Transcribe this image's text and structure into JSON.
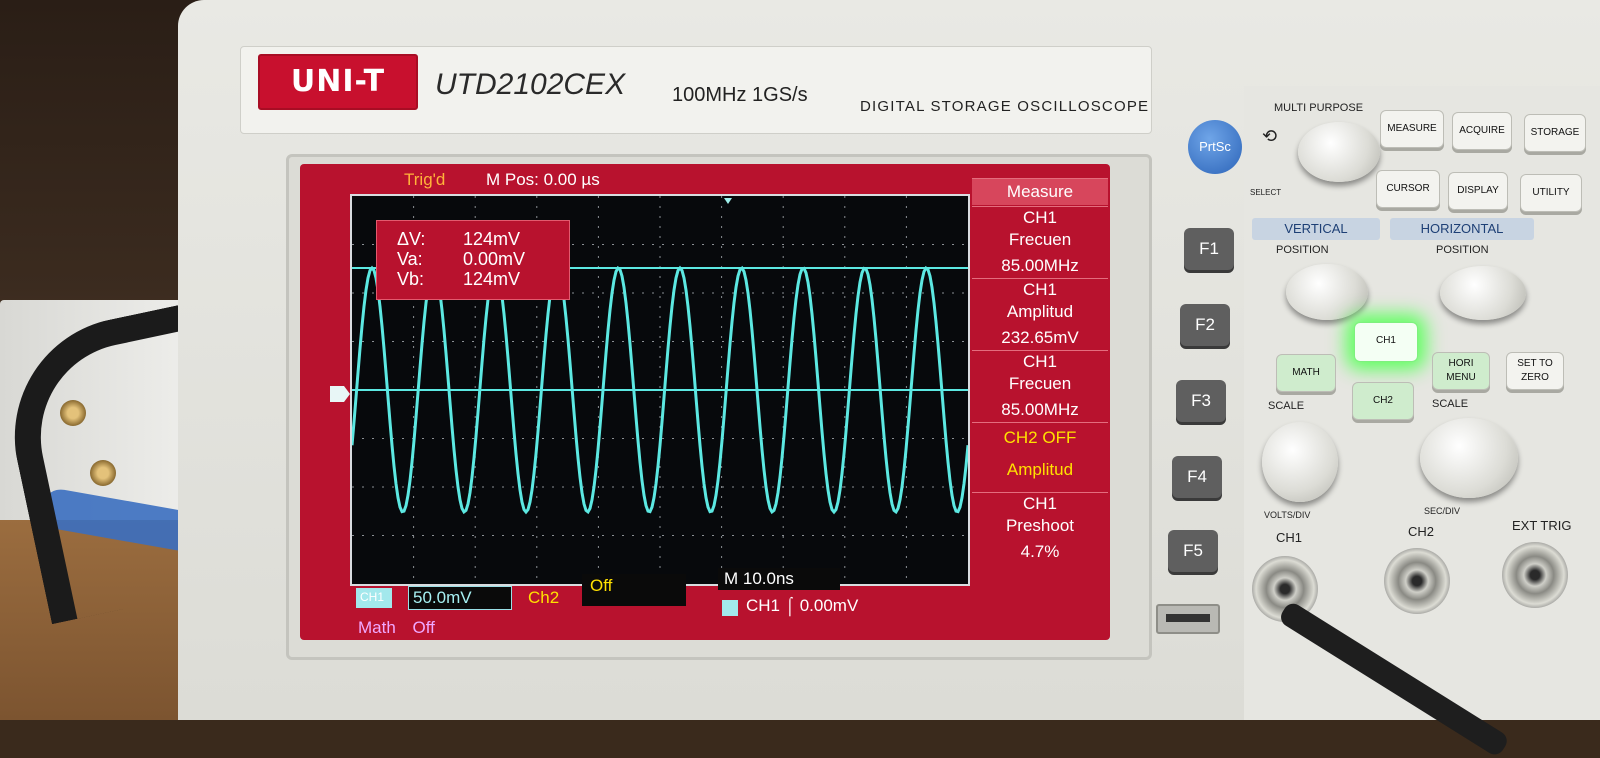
{
  "device": {
    "brand": "UNI-T",
    "model": "UTD2102CEX",
    "spec": "100MHz  1GS/s",
    "description": "DIGITAL STORAGE OSCILLOSCOPE"
  },
  "screen": {
    "status": "Trig'd",
    "m_pos": "M Pos: 0.00 µs",
    "cursor": {
      "dv_label": "ΔV:",
      "dv_value": "124mV",
      "va_label": "Va:",
      "va_value": "0.00mV",
      "vb_label": "Vb:",
      "vb_value": "124mV"
    },
    "menu": {
      "title": "Measure",
      "items": [
        {
          "line1": "CH1",
          "line2": "Frecuen",
          "value": "85.00MHz"
        },
        {
          "line1": "CH1",
          "line2": "Amplitud",
          "value": "232.65mV"
        },
        {
          "line1": "CH1",
          "line2": "Frecuen",
          "value": "85.00MHz"
        },
        {
          "line1": "CH2  OFF",
          "line2": "Amplitud",
          "value": ""
        },
        {
          "line1": "CH1",
          "line2": "Preshoot",
          "value": "4.7%"
        }
      ]
    },
    "bottom": {
      "ch1_tag": "CH1",
      "ch1_scale": "50.0mV",
      "ch2_label": "Ch2",
      "ch2_state": "Off",
      "timebase": "M  10.0ns",
      "trigger": "CH1  ⌠  0.00mV",
      "math_label": "Math",
      "math_state": "Off"
    },
    "waveform": {
      "cycles": 10,
      "type": "sine"
    }
  },
  "fkeys": [
    "F1",
    "F2",
    "F3",
    "F4",
    "F5"
  ],
  "controls": {
    "prtsc": "PrtSc",
    "multipurpose": "MULTI PURPOSE",
    "select": "SELECT",
    "buttons": [
      "MEASURE",
      "ACQUIRE",
      "STORAGE",
      "CURSOR",
      "DISPLAY",
      "UTILITY"
    ],
    "vertical": "VERTICAL",
    "horizontal": "HORIZONTAL",
    "position": "POSITION",
    "scale": "SCALE",
    "math": "MATH",
    "ch1": "CH1",
    "ch2": "CH2",
    "hori_menu": "HORI MENU",
    "set_to_zero": "SET TO ZERO",
    "volts_div": "VOLTS/DIV",
    "sec_div": "SEC/DIV",
    "ext_trig": "EXT TRIG",
    "colors": {
      "screen_red": "#b8122e",
      "trace": "#5ce8e2",
      "lit_button": "#61ff61"
    }
  }
}
